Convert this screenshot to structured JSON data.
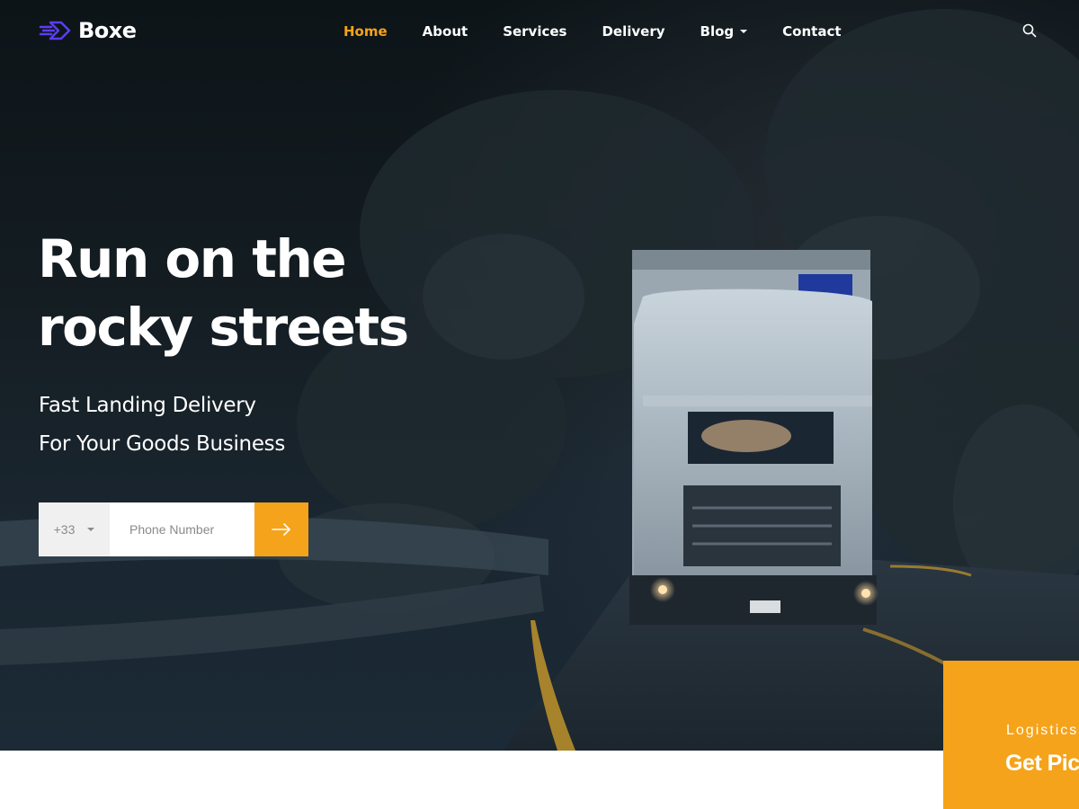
{
  "brand": {
    "name": "Boxe",
    "logo_icon": "box-speed-icon",
    "logo_color": "#5b3df5"
  },
  "nav": {
    "items": [
      {
        "label": "Home",
        "active": true
      },
      {
        "label": "About",
        "active": false
      },
      {
        "label": "Services",
        "active": false
      },
      {
        "label": "Delivery",
        "active": false
      },
      {
        "label": "Blog",
        "active": false,
        "has_dropdown": true
      },
      {
        "label": "Contact",
        "active": false
      }
    ],
    "search_icon": "search-icon"
  },
  "hero": {
    "title_line1": "Run on the",
    "title_line2": "rocky streets",
    "subtitle_line1": "Fast Landing Delivery",
    "subtitle_line2": "For Your Goods Business"
  },
  "phone_form": {
    "country_code": "+33",
    "placeholder": "Phone Number",
    "value": "",
    "submit_icon": "arrow-right-icon"
  },
  "callout": {
    "eyebrow": "Logistics",
    "title": "Get Pick"
  },
  "colors": {
    "accent": "#f5a31a",
    "hero_dark": "#141d22",
    "text_light": "#ffffff"
  }
}
